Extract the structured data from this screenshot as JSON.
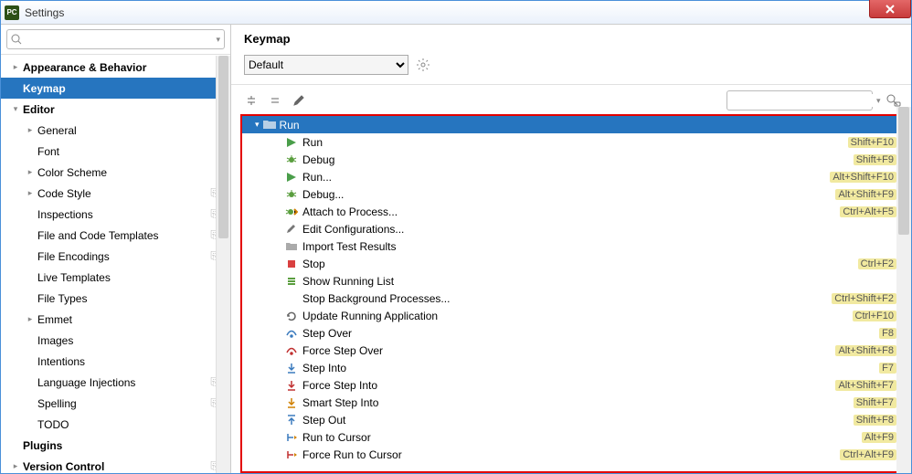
{
  "window": {
    "title": "Settings",
    "app_badge": "PC"
  },
  "sidebar": {
    "search_placeholder": "",
    "items": [
      {
        "label": "Appearance & Behavior",
        "level": 0,
        "chev": "right",
        "bold": true
      },
      {
        "label": "Keymap",
        "level": 0,
        "chev": "none",
        "bold": true,
        "selected": true
      },
      {
        "label": "Editor",
        "level": 0,
        "chev": "down",
        "bold": true
      },
      {
        "label": "General",
        "level": 1,
        "chev": "right"
      },
      {
        "label": "Font",
        "level": 1,
        "chev": "none"
      },
      {
        "label": "Color Scheme",
        "level": 1,
        "chev": "right"
      },
      {
        "label": "Code Style",
        "level": 1,
        "chev": "right",
        "badge": "⎘"
      },
      {
        "label": "Inspections",
        "level": 1,
        "chev": "none",
        "badge": "⎘"
      },
      {
        "label": "File and Code Templates",
        "level": 1,
        "chev": "none",
        "badge": "⎘"
      },
      {
        "label": "File Encodings",
        "level": 1,
        "chev": "none",
        "badge": "⎘"
      },
      {
        "label": "Live Templates",
        "level": 1,
        "chev": "none"
      },
      {
        "label": "File Types",
        "level": 1,
        "chev": "none"
      },
      {
        "label": "Emmet",
        "level": 1,
        "chev": "right"
      },
      {
        "label": "Images",
        "level": 1,
        "chev": "none"
      },
      {
        "label": "Intentions",
        "level": 1,
        "chev": "none"
      },
      {
        "label": "Language Injections",
        "level": 1,
        "chev": "none",
        "badge": "⎘"
      },
      {
        "label": "Spelling",
        "level": 1,
        "chev": "none",
        "badge": "⎘"
      },
      {
        "label": "TODO",
        "level": 1,
        "chev": "none"
      },
      {
        "label": "Plugins",
        "level": 0,
        "chev": "none",
        "bold": true
      },
      {
        "label": "Version Control",
        "level": 0,
        "chev": "right",
        "bold": true,
        "badge": "⎘"
      }
    ]
  },
  "main": {
    "heading": "Keymap",
    "profile": "Default",
    "search_placeholder": "",
    "group": "Run",
    "actions": [
      {
        "icon": "play",
        "label": "Run",
        "shortcut": "Shift+F10"
      },
      {
        "icon": "bug",
        "label": "Debug",
        "shortcut": "Shift+F9"
      },
      {
        "icon": "play",
        "label": "Run...",
        "shortcut": "Alt+Shift+F10"
      },
      {
        "icon": "bug",
        "label": "Debug...",
        "shortcut": "Alt+Shift+F9"
      },
      {
        "icon": "bug-attach",
        "label": "Attach to Process...",
        "shortcut": "Ctrl+Alt+F5"
      },
      {
        "icon": "pencil",
        "label": "Edit Configurations...",
        "shortcut": ""
      },
      {
        "icon": "folder",
        "label": "Import Test Results",
        "shortcut": ""
      },
      {
        "icon": "stop",
        "label": "Stop",
        "shortcut": "Ctrl+F2"
      },
      {
        "icon": "list",
        "label": "Show Running List",
        "shortcut": ""
      },
      {
        "icon": "none",
        "label": "Stop Background Processes...",
        "shortcut": "Ctrl+Shift+F2"
      },
      {
        "icon": "reload",
        "label": "Update Running Application",
        "shortcut": "Ctrl+F10"
      },
      {
        "icon": "step-over",
        "label": "Step Over",
        "shortcut": "F8"
      },
      {
        "icon": "force-over",
        "label": "Force Step Over",
        "shortcut": "Alt+Shift+F8"
      },
      {
        "icon": "step-into",
        "label": "Step Into",
        "shortcut": "F7"
      },
      {
        "icon": "force-into",
        "label": "Force Step Into",
        "shortcut": "Alt+Shift+F7"
      },
      {
        "icon": "smart-into",
        "label": "Smart Step Into",
        "shortcut": "Shift+F7"
      },
      {
        "icon": "step-out",
        "label": "Step Out",
        "shortcut": "Shift+F8"
      },
      {
        "icon": "cursor",
        "label": "Run to Cursor",
        "shortcut": "Alt+F9"
      },
      {
        "icon": "force-cursor",
        "label": "Force Run to Cursor",
        "shortcut": "Ctrl+Alt+F9"
      }
    ]
  }
}
